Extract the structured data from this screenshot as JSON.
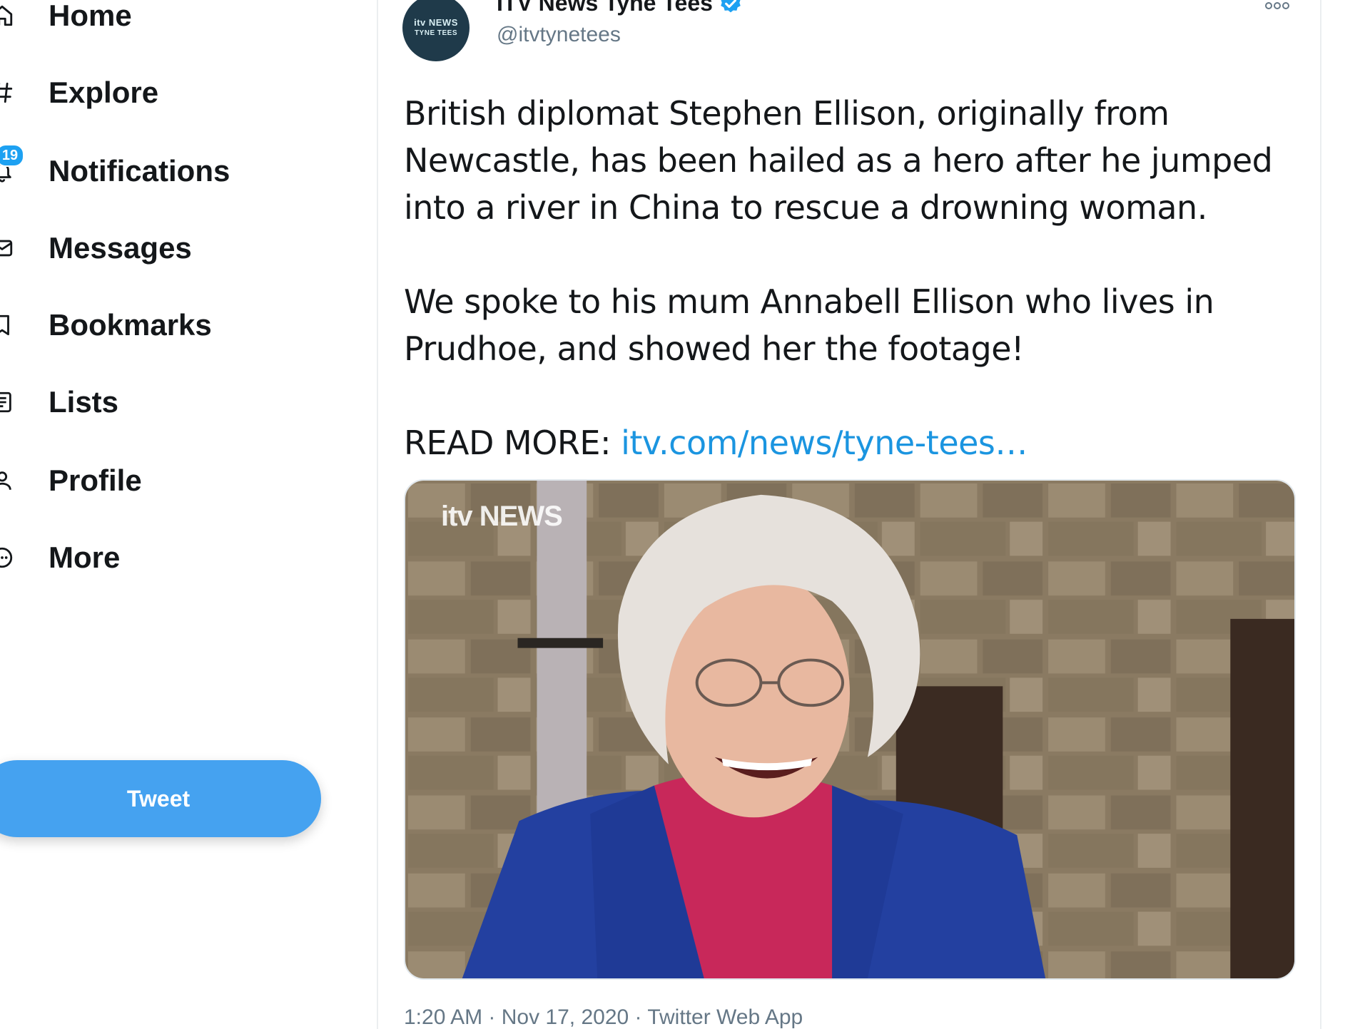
{
  "nav": {
    "items": [
      {
        "label": "Home",
        "icon": "home-icon"
      },
      {
        "label": "Explore",
        "icon": "hashtag-icon"
      },
      {
        "label": "Notifications",
        "icon": "bell-icon",
        "badge": "19"
      },
      {
        "label": "Messages",
        "icon": "envelope-icon"
      },
      {
        "label": "Bookmarks",
        "icon": "bookmark-icon"
      },
      {
        "label": "Lists",
        "icon": "list-icon"
      },
      {
        "label": "Profile",
        "icon": "person-icon"
      },
      {
        "label": "More",
        "icon": "more-circle-icon"
      }
    ],
    "tweet_button": "Tweet"
  },
  "tweet": {
    "author_name": "ITV News Tyne Tees",
    "author_handle": "@itvtynetees",
    "avatar_logo": "itv NEWS",
    "avatar_sub": "TYNE TEES",
    "verified": true,
    "paragraph_1": "British diplomat Stephen Ellison, originally from Newcastle, has been hailed as a hero after he jumped into a river in China to rescue a drowning woman.",
    "paragraph_2": "We spoke to his mum Annabell Ellison who lives in Prudhoe, and showed her the footage!",
    "read_more_label": "READ MORE: ",
    "read_more_link": "itv.com/news/tyne-tees…",
    "media_watermark": "itv NEWS",
    "time": "1:20 AM",
    "date": "Nov 17, 2020",
    "source": "Twitter Web App",
    "separator": " · "
  },
  "colors": {
    "accent": "#1da1f2",
    "link": "#1b95e0",
    "muted": "#657786",
    "tweet_button": "#45a2f0"
  }
}
